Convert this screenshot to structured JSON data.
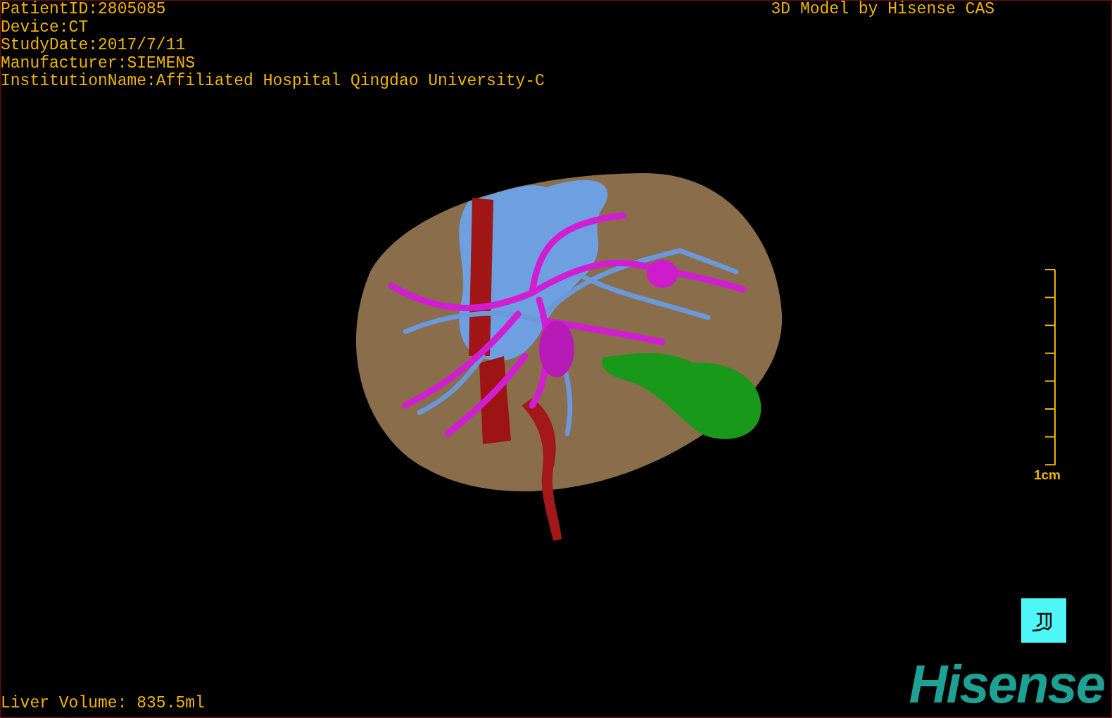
{
  "patient_info": [
    "PatientID:2805085",
    "Device:CT",
    "StudyDate:2017/7/11",
    "Manufacturer:SIEMENS",
    "InstitutionName:Affiliated Hospital Qingdao University-C"
  ],
  "title": "3D Model by Hisense CAS",
  "scale_bar": {
    "label": "1cm"
  },
  "liver_volume": "Liver Volume: 835.5ml",
  "logo": "Hisense"
}
